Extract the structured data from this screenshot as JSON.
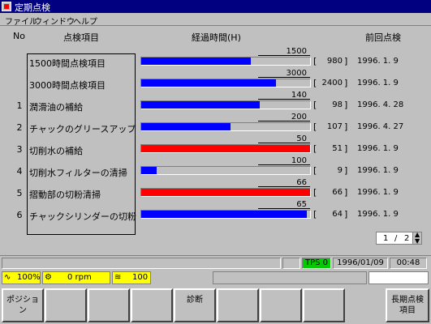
{
  "window": {
    "title": "定期点検"
  },
  "menu": [
    "ファイル",
    "ウィンドウ",
    "ヘルプ"
  ],
  "headers": {
    "no": "No",
    "item": "点検項目",
    "elapsed": "経過時間(H)",
    "last": "前回点検"
  },
  "rows": [
    {
      "no": "",
      "name": "1500時間点検項目",
      "max": "1500",
      "current": "980",
      "ratio": 0.65,
      "color": "#0000ff",
      "date": "1996. 1. 9"
    },
    {
      "no": "",
      "name": "3000時間点検項目",
      "max": "3000",
      "current": "2400",
      "ratio": 0.8,
      "color": "#0000ff",
      "date": "1996. 1. 9"
    },
    {
      "no": "1",
      "name": "潤滑油の補給",
      "max": "140",
      "current": "98",
      "ratio": 0.7,
      "color": "#0000ff",
      "date": "1996. 4. 28"
    },
    {
      "no": "2",
      "name": "チャックのグリースアップ",
      "max": "200",
      "current": "107",
      "ratio": 0.53,
      "color": "#0000ff",
      "date": "1996. 4. 27"
    },
    {
      "no": "3",
      "name": "切削水の補給",
      "max": "50",
      "current": "51",
      "ratio": 1.0,
      "color": "#ff0000",
      "date": "1996. 1. 9"
    },
    {
      "no": "4",
      "name": "切削水フィルターの清掃",
      "max": "100",
      "current": "9",
      "ratio": 0.09,
      "color": "#0000ff",
      "date": "1996. 1. 9"
    },
    {
      "no": "5",
      "name": "摺動部の切粉清掃",
      "max": "66",
      "current": "66",
      "ratio": 1.0,
      "color": "#ff0000",
      "date": "1996. 1. 9"
    },
    {
      "no": "6",
      "name": "チャックシリンダーの切粉清掃",
      "max": "65",
      "current": "64",
      "ratio": 0.98,
      "color": "#0000ff",
      "date": "1996. 1. 9"
    }
  ],
  "pager": {
    "current": "1",
    "total": "2"
  },
  "status": {
    "tps": "TPS 0",
    "date": "1996/01/09",
    "time": "00:48"
  },
  "info": {
    "override": "100%",
    "spindle": "0 rpm",
    "feed": "100"
  },
  "fkeys": [
    "ポジション",
    "",
    "",
    "",
    "診断",
    "",
    "",
    "",
    "長期点検\n項目"
  ]
}
